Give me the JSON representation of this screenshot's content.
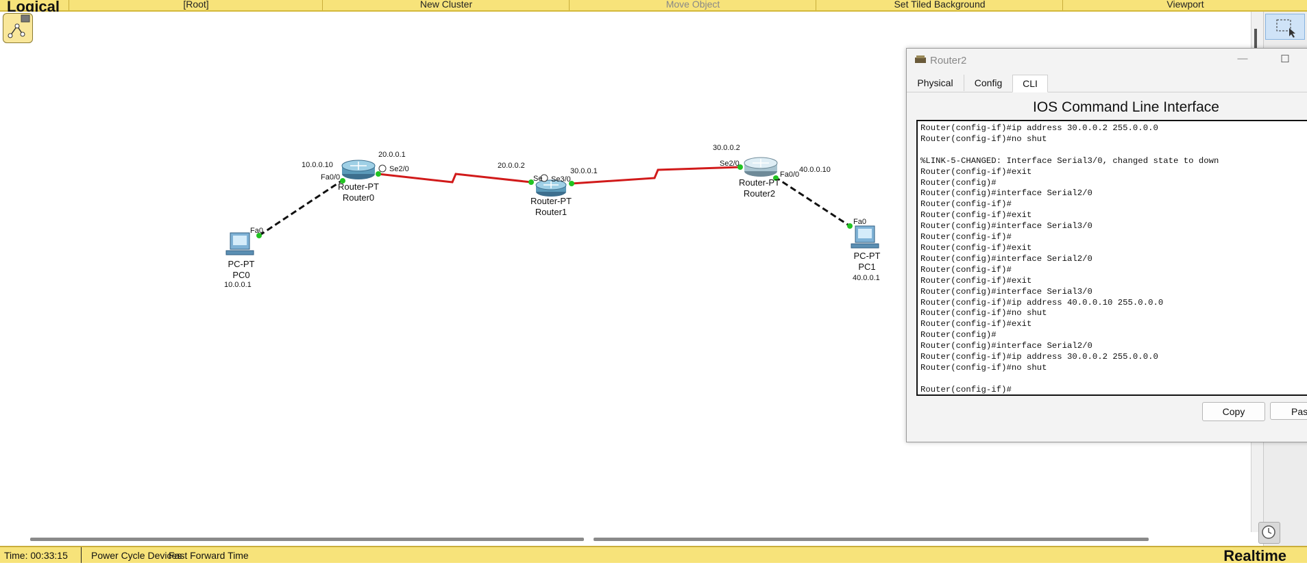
{
  "toolbar": {
    "title": "Logical",
    "items": [
      {
        "label": "[Root]",
        "enabled": true
      },
      {
        "label": "New Cluster",
        "enabled": true
      },
      {
        "label": "Move Object",
        "enabled": false
      },
      {
        "label": "Set Tiled Background",
        "enabled": true
      },
      {
        "label": "Viewport",
        "enabled": true
      }
    ]
  },
  "topology": {
    "devices": [
      {
        "id": "pc0",
        "model": "PC-PT",
        "name": "PC0",
        "ip": "10.0.0.1",
        "port": "Fa0"
      },
      {
        "id": "router0",
        "model": "Router-PT",
        "name": "Router0",
        "labels": [
          "10.0.0.10",
          "Fa0/0",
          "20.0.0.1",
          "Se2/0"
        ]
      },
      {
        "id": "router1",
        "model": "Router-PT",
        "name": "Router1",
        "labels": [
          "20.0.0.2",
          "Se",
          "Se3/0",
          "30.0.0.1"
        ]
      },
      {
        "id": "router2",
        "model": "Router-PT",
        "name": "Router2",
        "labels": [
          "30.0.0.2",
          "Se2/0",
          "Fa0/0",
          "40.0.0.10"
        ]
      },
      {
        "id": "pc1",
        "model": "PC-PT",
        "name": "PC1",
        "ip": "40.0.0.1",
        "port": "Fa0"
      }
    ],
    "links": [
      {
        "from": "pc0",
        "to": "router0",
        "type": "copper-crossover",
        "color": "#111111"
      },
      {
        "from": "router0",
        "to": "router1",
        "type": "serial",
        "color": "#d11a1a"
      },
      {
        "from": "router1",
        "to": "router2",
        "type": "serial",
        "color": "#d11a1a"
      },
      {
        "from": "router2",
        "to": "pc1",
        "type": "copper-crossover",
        "color": "#111111"
      }
    ],
    "port_status_color": "#22c322"
  },
  "dialog": {
    "title": "Router2",
    "tabs": [
      {
        "label": "Physical",
        "active": false
      },
      {
        "label": "Config",
        "active": false
      },
      {
        "label": "CLI",
        "active": true
      }
    ],
    "heading": "IOS Command Line Interface",
    "cli_lines": [
      "Router(config-if)#ip address 30.0.0.2 255.0.0.0",
      "Router(config-if)#no shut",
      "",
      "%LINK-5-CHANGED: Interface Serial3/0, changed state to down",
      "Router(config-if)#exit",
      "Router(config)#",
      "Router(config)#interface Serial2/0",
      "Router(config-if)#",
      "Router(config-if)#exit",
      "Router(config)#interface Serial3/0",
      "Router(config-if)#",
      "Router(config-if)#exit",
      "Router(config)#interface Serial2/0",
      "Router(config-if)#",
      "Router(config-if)#exit",
      "Router(config)#interface Serial3/0",
      "Router(config-if)#ip address 40.0.0.10 255.0.0.0",
      "Router(config-if)#no shut",
      "Router(config-if)#exit",
      "Router(config)#",
      "Router(config)#interface Serial2/0",
      "Router(config-if)#ip address 30.0.0.2 255.0.0.0",
      "Router(config-if)#no shut",
      "",
      "Router(config-if)#"
    ],
    "copy_label": "Copy",
    "paste_label": "Past"
  },
  "statusbar": {
    "time": "Time: 00:33:15",
    "power_cycle": "Power Cycle Devices",
    "fast_forward": "Fast Forward Time",
    "mode": "Realtime"
  }
}
